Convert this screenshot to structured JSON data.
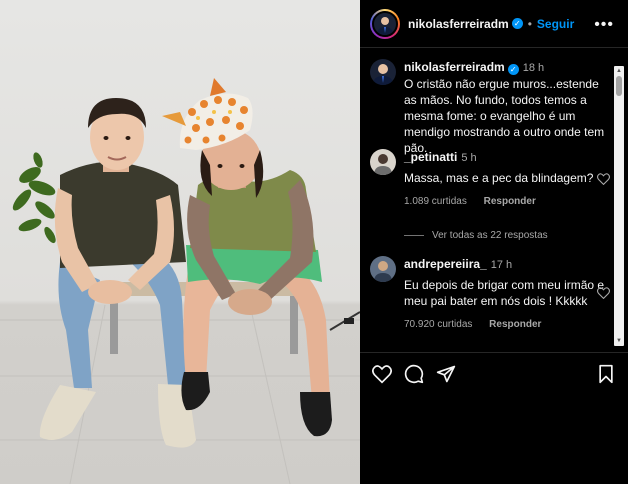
{
  "header": {
    "username": "nikolasferreiradm",
    "follow_label": "Seguir",
    "more_label": "•••"
  },
  "caption": {
    "username": "nikolasferreiradm",
    "time": "18 h",
    "text": "O cristão não ergue muros...estende as mãos. No fundo, todos temos a mesma fome: o evangelho é um mendigo mostrando a outro onde tem pão."
  },
  "comments": [
    {
      "username": "_petinatti",
      "time": "5 h",
      "text": "Massa, mas e a pec da blindagem?",
      "likes": "1.089 curtidas",
      "reply_label": "Responder"
    },
    {
      "username": "andrepereiira_",
      "time": "17 h",
      "text": "Eu depois de brigar com meu irmão e meu pai bater em nós dois ! Kkkkk",
      "likes": "70.920 curtidas",
      "reply_label": "Responder"
    }
  ],
  "view_replies_label": "Ver todas as 22 respostas",
  "icons": {
    "like": "heart-icon",
    "comment": "comment-icon",
    "share": "send-icon",
    "save": "bookmark-icon",
    "verified": "verified-badge-icon"
  },
  "colors": {
    "accent": "#0095f6",
    "secondary_text": "#a8a8a8",
    "background": "#000000"
  }
}
